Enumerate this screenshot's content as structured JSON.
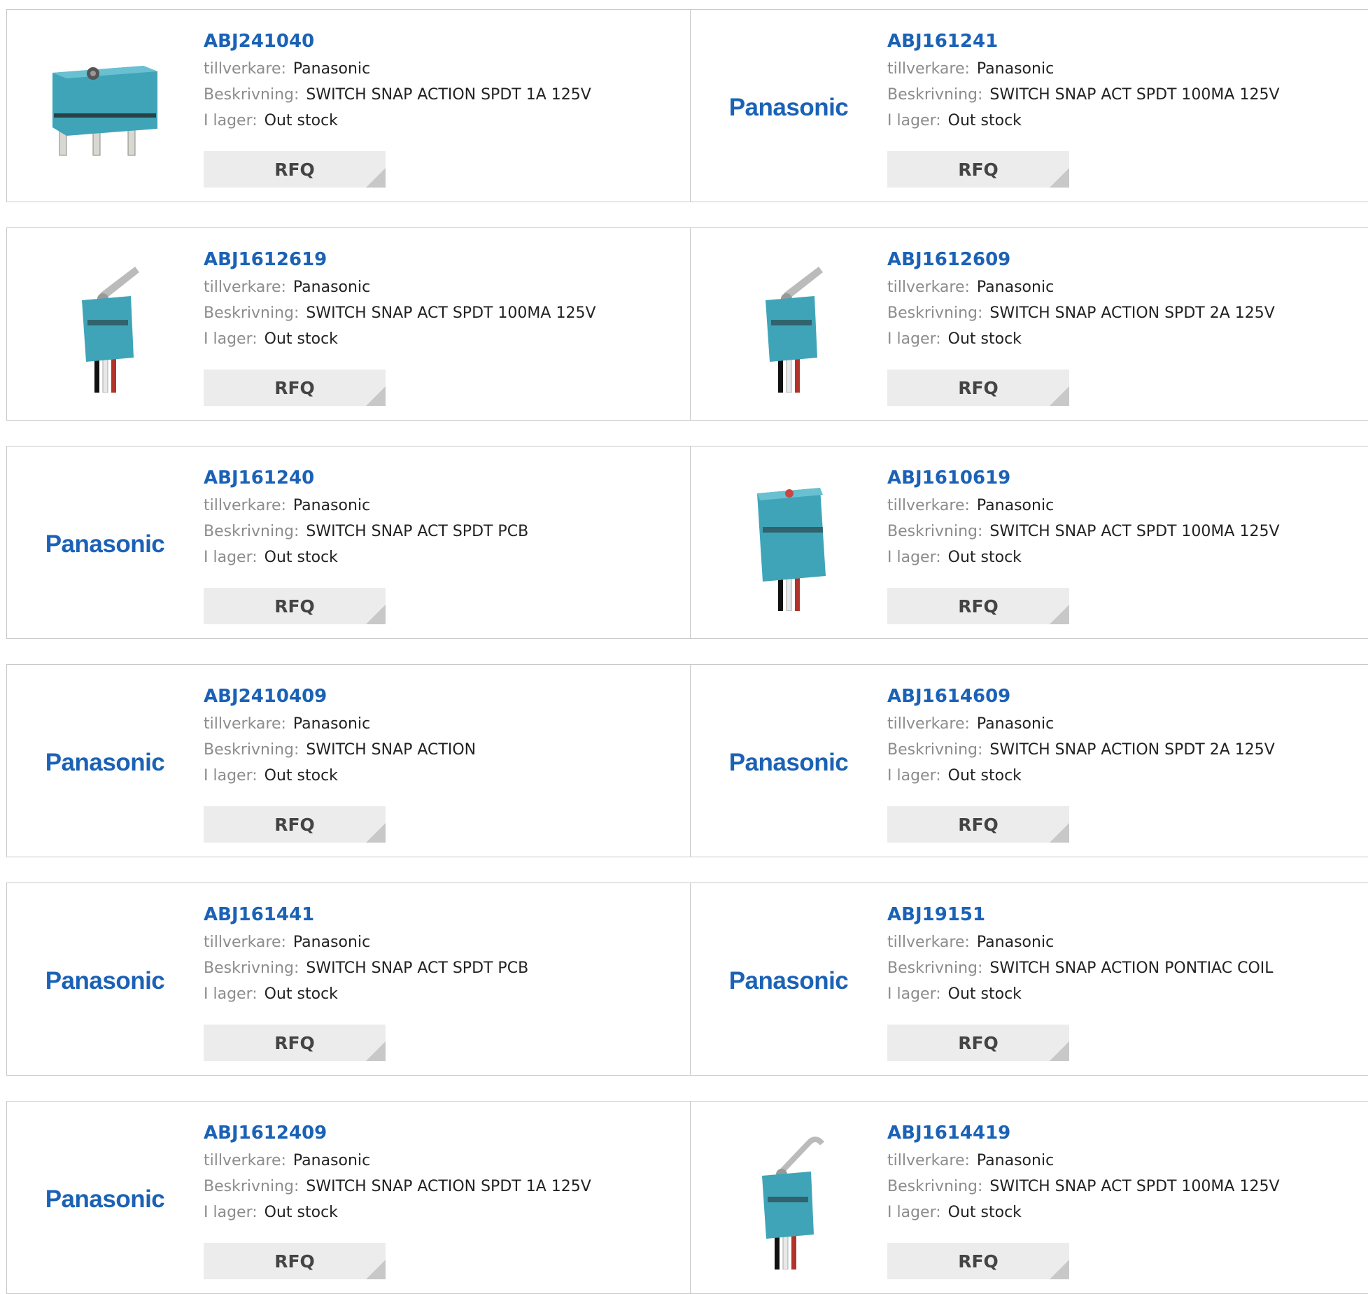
{
  "labels": {
    "manufacturer": "tillverkare:",
    "description": "Beskrivning:",
    "stock": "I lager:",
    "rfq": "RFQ",
    "logo": "Panasonic"
  },
  "products": [
    {
      "part": "ABJ241040",
      "manufacturer": "Panasonic",
      "description": "SWITCH SNAP ACTION SPDT 1A 125V",
      "stock": "Out stock",
      "image": "switch-body-icon"
    },
    {
      "part": "ABJ161241",
      "manufacturer": "Panasonic",
      "description": "SWITCH SNAP ACT SPDT 100MA 125V",
      "stock": "Out stock",
      "image": "panasonic-logo"
    },
    {
      "part": "ABJ1612619",
      "manufacturer": "Panasonic",
      "description": "SWITCH SNAP ACT SPDT 100MA 125V",
      "stock": "Out stock",
      "image": "switch-lever-icon"
    },
    {
      "part": "ABJ1612609",
      "manufacturer": "Panasonic",
      "description": "SWITCH SNAP ACTION SPDT 2A 125V",
      "stock": "Out stock",
      "image": "switch-lever-icon"
    },
    {
      "part": "ABJ161240",
      "manufacturer": "Panasonic",
      "description": "SWITCH SNAP ACT SPDT PCB",
      "stock": "Out stock",
      "image": "panasonic-logo"
    },
    {
      "part": "ABJ1610619",
      "manufacturer": "Panasonic",
      "description": "SWITCH SNAP ACT SPDT 100MA 125V",
      "stock": "Out stock",
      "image": "switch-wired-icon"
    },
    {
      "part": "ABJ2410409",
      "manufacturer": "Panasonic",
      "description": "SWITCH SNAP ACTION",
      "stock": "Out stock",
      "image": "panasonic-logo"
    },
    {
      "part": "ABJ1614609",
      "manufacturer": "Panasonic",
      "description": "SWITCH SNAP ACTION SPDT 2A 125V",
      "stock": "Out stock",
      "image": "panasonic-logo"
    },
    {
      "part": "ABJ161441",
      "manufacturer": "Panasonic",
      "description": "SWITCH SNAP ACT SPDT PCB",
      "stock": "Out stock",
      "image": "panasonic-logo"
    },
    {
      "part": "ABJ19151",
      "manufacturer": "Panasonic",
      "description": "SWITCH SNAP ACTION PONTIAC COIL",
      "stock": "Out stock",
      "image": "panasonic-logo"
    },
    {
      "part": "ABJ1612409",
      "manufacturer": "Panasonic",
      "description": "SWITCH SNAP ACTION SPDT 1A 125V",
      "stock": "Out stock",
      "image": "panasonic-logo"
    },
    {
      "part": "ABJ1614419",
      "manufacturer": "Panasonic",
      "description": "SWITCH SNAP ACT SPDT 100MA 125V",
      "stock": "Out stock",
      "image": "switch-hook-lever-icon"
    }
  ],
  "colors": {
    "link": "#1b62b6",
    "label": "#8c8c8c",
    "switch_body": "#3fa4b8"
  }
}
